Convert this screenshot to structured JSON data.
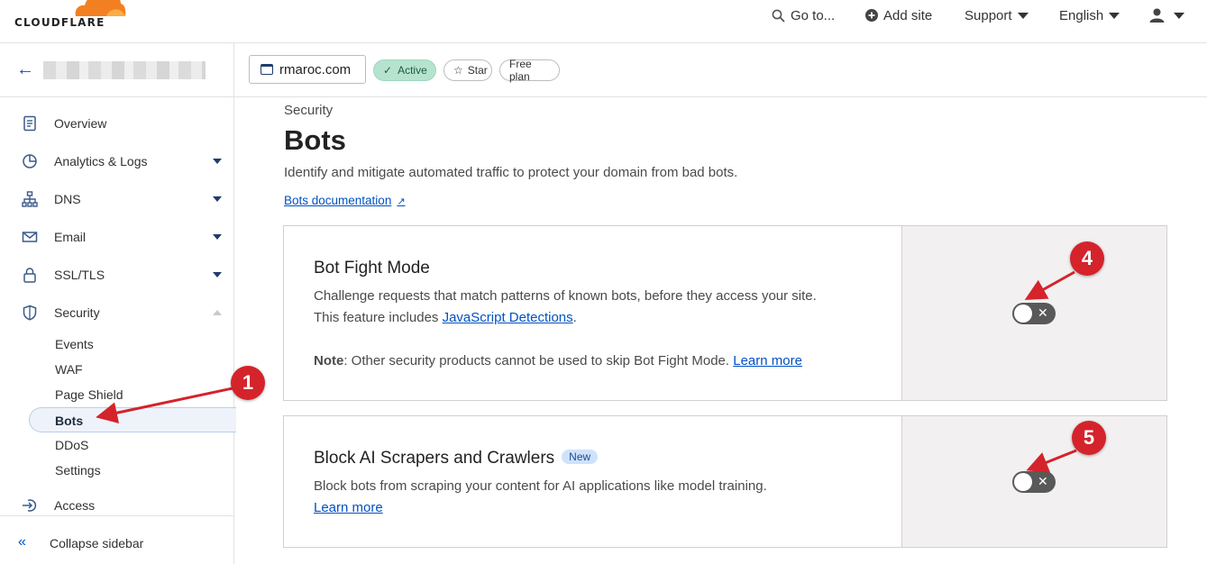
{
  "topbar": {
    "brand": "CLOUDFLARE",
    "goto_label": "Go to...",
    "add_site_label": "Add site",
    "support_label": "Support",
    "language_label": "English"
  },
  "sidebar": {
    "items": [
      {
        "label": "Overview",
        "icon": "document-icon"
      },
      {
        "label": "Analytics & Logs",
        "icon": "pie-chart-icon"
      },
      {
        "label": "DNS",
        "icon": "network-icon"
      },
      {
        "label": "Email",
        "icon": "envelope-icon"
      },
      {
        "label": "SSL/TLS",
        "icon": "lock-icon"
      },
      {
        "label": "Security",
        "icon": "shield-icon"
      }
    ],
    "security_subitems": [
      "Events",
      "WAF",
      "Page Shield",
      "Bots",
      "DDoS",
      "Settings"
    ],
    "access_label": "Access",
    "collapse_label": "Collapse sidebar"
  },
  "zone": {
    "domain": "rmaroc.com",
    "status": "Active",
    "star_label": "Star",
    "plan": "Free plan"
  },
  "page": {
    "breadcrumb": "Security",
    "title": "Bots",
    "description": "Identify and mitigate automated traffic to protect your domain from bad bots.",
    "doc_link": "Bots documentation"
  },
  "cards": {
    "bot_fight": {
      "title": "Bot Fight Mode",
      "line1": "Challenge requests that match patterns of known bots, before they access your site.",
      "line2_prefix": "This feature includes ",
      "line2_link": "JavaScript Detections",
      "line2_suffix": ".",
      "note_label": "Note",
      "note_text": ": Other security products cannot be used to skip Bot Fight Mode. ",
      "note_link": "Learn more",
      "toggle_state": "off"
    },
    "ai_scrapers": {
      "title": "Block AI Scrapers and Crawlers",
      "badge": "New",
      "line1": "Block bots from scraping your content for AI applications like model training.",
      "link": "Learn more",
      "toggle_state": "off"
    }
  },
  "annotations": {
    "marker_1": "1",
    "marker_4": "4",
    "marker_5": "5",
    "color": "#d4232b"
  },
  "colors": {
    "accent": "#0051c3",
    "active_pill": "#b6e3cf",
    "brand_orange": "#f38020"
  }
}
